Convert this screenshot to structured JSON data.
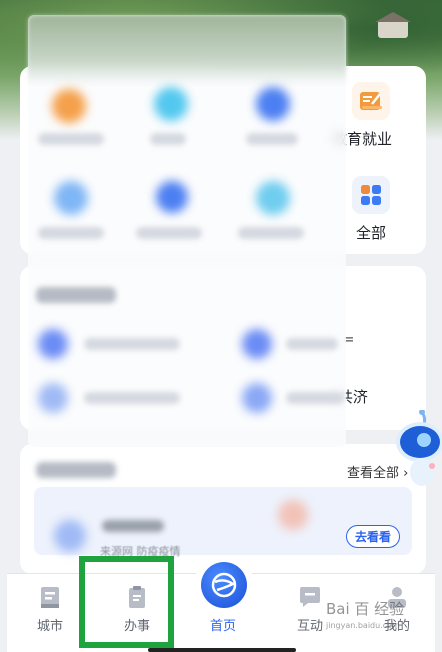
{
  "services": {
    "edu_label": "教育就业",
    "all_label": "全部",
    "edu_icon": "edu-briefcase-icon",
    "all_icon": "grid-all-icon"
  },
  "section2": {
    "partial_1": "=",
    "partial_2": "z共济"
  },
  "section3": {
    "view_all": "查看全部 ›",
    "go_button": "去看看",
    "snippet": "来源网 防疫疫情"
  },
  "nav": {
    "items": [
      {
        "label": "城市",
        "icon": "city-icon"
      },
      {
        "label": "办事",
        "icon": "tasks-icon"
      },
      {
        "label": "首页",
        "icon": "home-globe-icon"
      },
      {
        "label": "互动",
        "icon": "chat-icon"
      },
      {
        "label": "我的",
        "icon": "profile-icon"
      }
    ],
    "active_color": "#2b63f0",
    "highlight_color": "#1fa33f"
  },
  "watermark": {
    "line1": "Bai 百 经验",
    "line2": "jingyan.baidu.com"
  }
}
